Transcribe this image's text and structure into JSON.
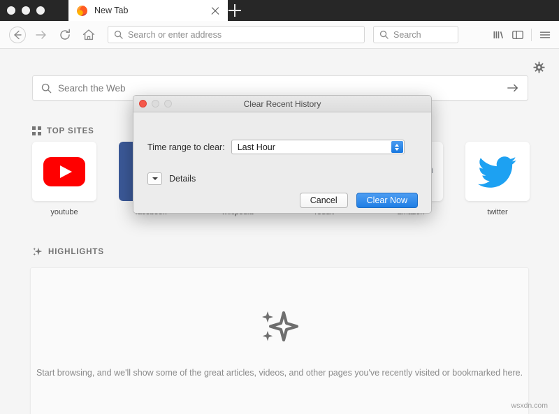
{
  "window": {
    "traffic_lights": [
      "close",
      "minimize",
      "maximize"
    ]
  },
  "tabbar": {
    "tab_title": "New Tab",
    "close_icon": "close-icon",
    "new_tab_icon": "plus-icon"
  },
  "toolbar": {
    "back_icon": "back-arrow-icon",
    "forward_icon": "forward-arrow-icon",
    "reload_icon": "reload-icon",
    "home_icon": "home-icon",
    "address_placeholder": "Search or enter address",
    "search_placeholder": "Search",
    "library_icon": "library-icon",
    "sidebar_icon": "sidebar-icon",
    "menu_icon": "hamburger-menu-icon"
  },
  "newtab": {
    "gear_icon": "gear-icon",
    "web_search_placeholder": "Search the Web",
    "go_arrow_icon": "arrow-right-icon",
    "top_sites": {
      "heading": "TOP SITES",
      "icon": "grid-icon",
      "tiles": [
        {
          "label": "youtube",
          "icon": "youtube-logo",
          "color": "#ff0000"
        },
        {
          "label": "facebook",
          "icon": "facebook-logo",
          "color": "#3b5998"
        },
        {
          "label": "wikipedia",
          "icon": "wikipedia-logo",
          "color": "#ffffff"
        },
        {
          "label": "reddit",
          "icon": "reddit-logo",
          "color": "#ff4500"
        },
        {
          "label": "amazon",
          "icon": "amazon-logo",
          "color": "#ff9900"
        },
        {
          "label": "twitter",
          "icon": "twitter-logo",
          "color": "#1da1f2"
        }
      ]
    },
    "highlights": {
      "heading": "HIGHLIGHTS",
      "icon": "sparkle-icon",
      "empty_icon": "sparkle-icon",
      "empty_text": "Start browsing, and we'll show some of the great articles, videos, and other pages you've recently visited or bookmarked here."
    }
  },
  "dialog": {
    "title": "Clear Recent History",
    "lights": [
      "close",
      "minimize",
      "maximize"
    ],
    "time_range_label": "Time range to clear:",
    "time_range_value": "Last Hour",
    "stepper_icon": "stepper-updown-icon",
    "details_label": "Details",
    "details_disclosure_icon": "chevron-down-icon",
    "cancel_label": "Cancel",
    "clear_label": "Clear Now",
    "accent_color": "#1f7ee4"
  },
  "watermark": "wsxdn.com"
}
